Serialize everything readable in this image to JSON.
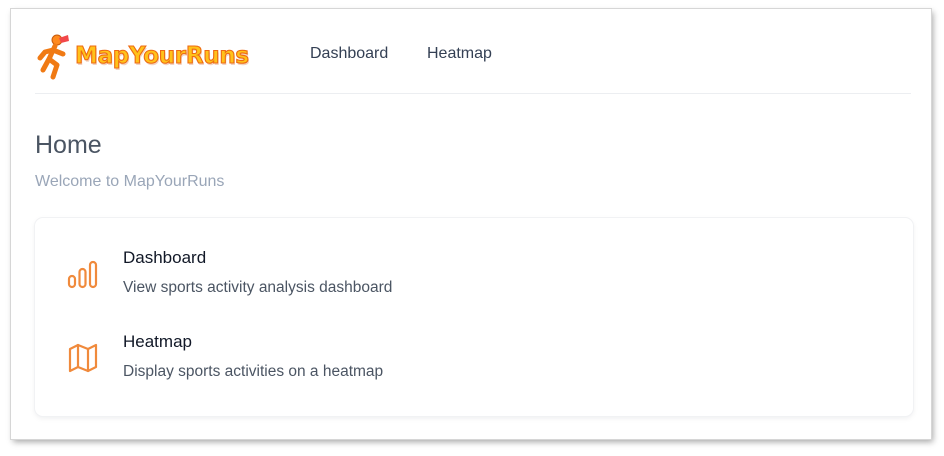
{
  "app": {
    "name": "MapYourRuns",
    "brand_colors": {
      "fill": "#ffc21a",
      "outline": "#ee6a12"
    },
    "logo_icon": "runner-icon"
  },
  "nav": {
    "links": [
      {
        "label": "Dashboard"
      },
      {
        "label": "Heatmap"
      }
    ]
  },
  "page": {
    "title": "Home",
    "subtitle": "Welcome to MapYourRuns"
  },
  "menu": {
    "accent_color": "#f08a3c",
    "items": [
      {
        "icon": "bar-chart-icon",
        "title": "Dashboard",
        "description": "View sports activity analysis dashboard"
      },
      {
        "icon": "map-icon",
        "title": "Heatmap",
        "description": "Display sports activities on a heatmap"
      }
    ]
  }
}
